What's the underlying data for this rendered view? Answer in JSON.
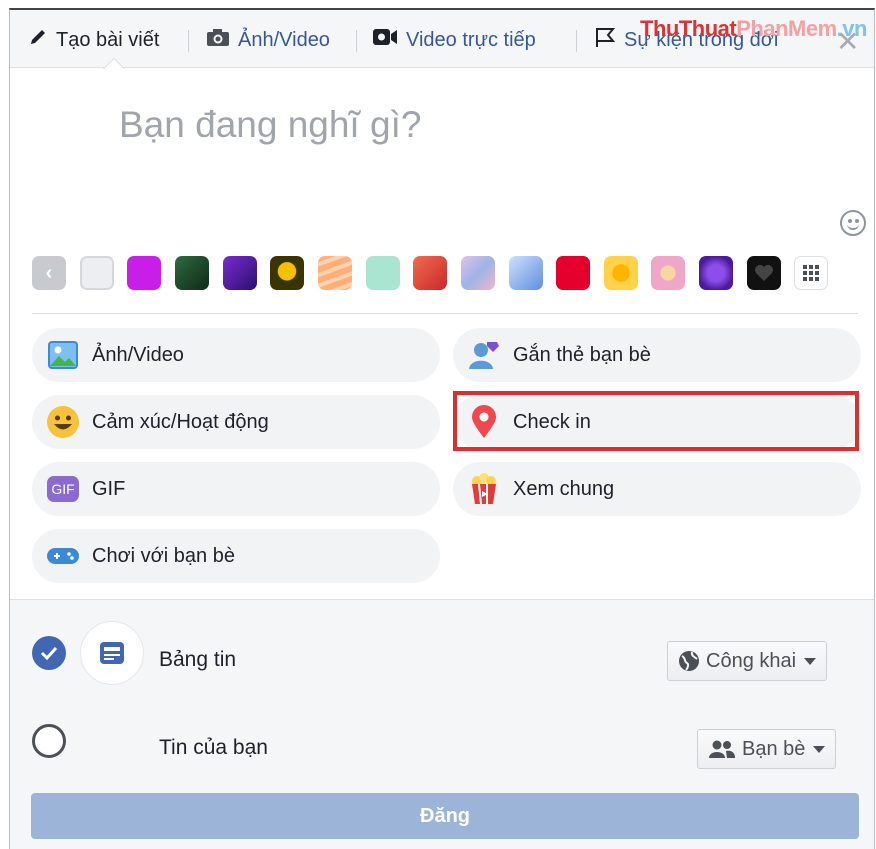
{
  "tabs": {
    "create_post": "Tạo bài viết",
    "photo_video": "Ảnh/Video",
    "live_video": "Video trực tiếp",
    "life_event": "Sự kiện trong đời"
  },
  "watermark": {
    "part1": "Thu",
    "part2": "Thuat",
    "part3": "PhanMem",
    "part4": ".vn"
  },
  "composer": {
    "placeholder": "Bạn đang nghĩ gì?"
  },
  "backgrounds": [
    {
      "name": "plain",
      "color": "#eceef1"
    },
    {
      "name": "magenta",
      "color": "#c81ee8"
    },
    {
      "name": "leaves",
      "color": "#1f4d2c"
    },
    {
      "name": "purple-wave",
      "color": "#4b1fa0"
    },
    {
      "name": "yellow-shape",
      "color": "#3a3400"
    },
    {
      "name": "orange-stripes",
      "color": "#ffb07a"
    },
    {
      "name": "mint",
      "color": "#a9e5d0"
    },
    {
      "name": "red-pattern",
      "color": "#e64b3c"
    },
    {
      "name": "pastel-swirl",
      "color": "#c8b6e2"
    },
    {
      "name": "blue-gradient",
      "color": "#7fa8e8"
    },
    {
      "name": "crimson",
      "color": "#e4002b"
    },
    {
      "name": "citrus",
      "color": "#ffd24a"
    },
    {
      "name": "donut",
      "color": "#f0a6c8"
    },
    {
      "name": "violet-orb",
      "color": "#6a2bc0"
    },
    {
      "name": "black-heart",
      "color": "#111111"
    }
  ],
  "actions": {
    "photo_video": "Ảnh/Video",
    "tag_friends": "Gắn thẻ bạn bè",
    "feeling_activity": "Cảm xúc/Hoạt động",
    "check_in": "Check in",
    "gif": "GIF",
    "gif_badge": "GIF",
    "watch_party": "Xem chung",
    "play_with_friends": "Chơi với bạn bè"
  },
  "audience": {
    "news_feed": {
      "label": "Bảng tin",
      "checked": true,
      "privacy": "Công khai"
    },
    "your_story": {
      "label": "Tin của bạn",
      "checked": false,
      "privacy": "Bạn bè"
    }
  },
  "post_button": "Đăng",
  "colors": {
    "accent": "#4267b2",
    "link": "#365899",
    "highlight_box": "#e02d2d",
    "post_button_disabled": "#9cb4d8"
  }
}
